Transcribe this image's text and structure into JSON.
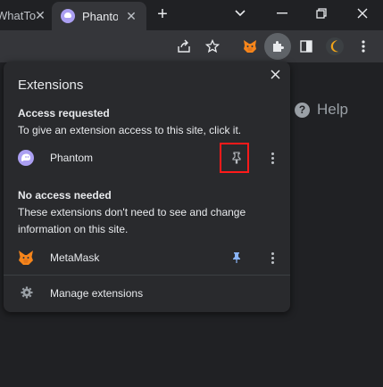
{
  "tabs": {
    "inactive_label": "WhatTo",
    "active_label": "Phanto",
    "new_tab_symbol": "+"
  },
  "window_controls": {
    "minimize": "—",
    "restore": "❐",
    "close": "✕",
    "tab_search": "⌄"
  },
  "toolbar": {
    "share_icon": "share-icon",
    "star_icon": "bookmark-star-icon",
    "extensions_icon": "puzzle-icon",
    "sidepanel_icon": "side-panel-icon",
    "menu_icon": "kebab-icon"
  },
  "page": {
    "help_label": "Help",
    "help_q": "?"
  },
  "popup": {
    "title": "Extensions",
    "close": "✕",
    "access_requested": {
      "heading": "Access requested",
      "description": "To give an extension access to this site, click it."
    },
    "no_access": {
      "heading": "No access needed",
      "description": "These extensions don't need to see and change information on this site."
    },
    "extensions": [
      {
        "name": "Phantom",
        "pinned": false
      },
      {
        "name": "MetaMask",
        "pinned": true
      }
    ],
    "manage_label": "Manage extensions"
  },
  "colors": {
    "highlight": "#ff1a1a",
    "pinned": "#8ab4f8",
    "phantom": "#ab9ff2",
    "metamask": "#f6851b"
  }
}
